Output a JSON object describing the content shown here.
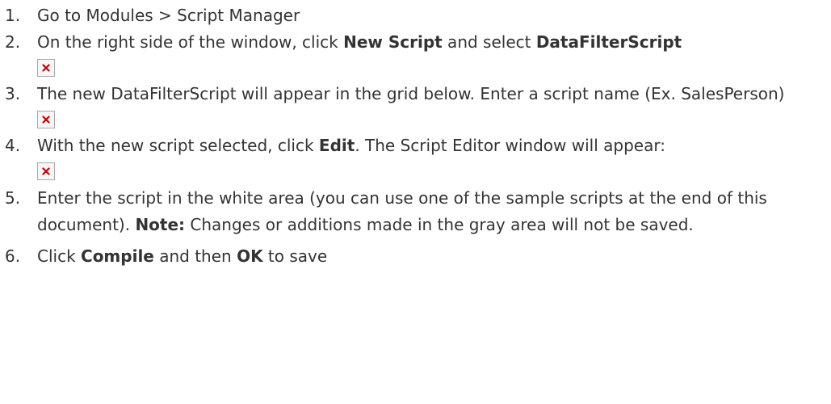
{
  "steps": [
    {
      "number": "1.",
      "parts": [
        {
          "text": "Go to Modules > Script Manager",
          "bold": false
        }
      ],
      "has_image": false
    },
    {
      "number": "2.",
      "parts": [
        {
          "text": "On the right side of the window, click ",
          "bold": false
        },
        {
          "text": "New Script",
          "bold": true
        },
        {
          "text": " and select ",
          "bold": false
        },
        {
          "text": "DataFilterScript",
          "bold": true
        }
      ],
      "has_image": true
    },
    {
      "number": "3.",
      "parts": [
        {
          "text": "The new DataFilterScript will appear in the grid below. Enter a script name (Ex. SalesPerson)",
          "bold": false
        }
      ],
      "has_image": true
    },
    {
      "number": "4.",
      "parts": [
        {
          "text": "With the new script selected, click ",
          "bold": false
        },
        {
          "text": "Edit",
          "bold": true
        },
        {
          "text": ". The Script Editor window will appear:",
          "bold": false
        }
      ],
      "has_image": true
    },
    {
      "number": "5.",
      "parts": [
        {
          "text": "Enter the script in the white area (you can use one of the sample scripts at the end of this document). ",
          "bold": false
        },
        {
          "text": "Note:",
          "bold": true
        },
        {
          "text": " Changes or additions made in the gray area will not be saved.",
          "bold": false
        }
      ],
      "has_image": false
    },
    {
      "number": "6.",
      "parts": [
        {
          "text": "Click ",
          "bold": false
        },
        {
          "text": "Compile",
          "bold": true
        },
        {
          "text": " and then ",
          "bold": false
        },
        {
          "text": "OK",
          "bold": true
        },
        {
          "text": " to save",
          "bold": false
        }
      ],
      "has_image": false
    }
  ],
  "colors": {
    "text": "#333333",
    "broken_image_x": "#cc0000",
    "broken_image_border": "#a9a9a9"
  },
  "icons": {
    "broken_image": "broken-image-icon"
  }
}
